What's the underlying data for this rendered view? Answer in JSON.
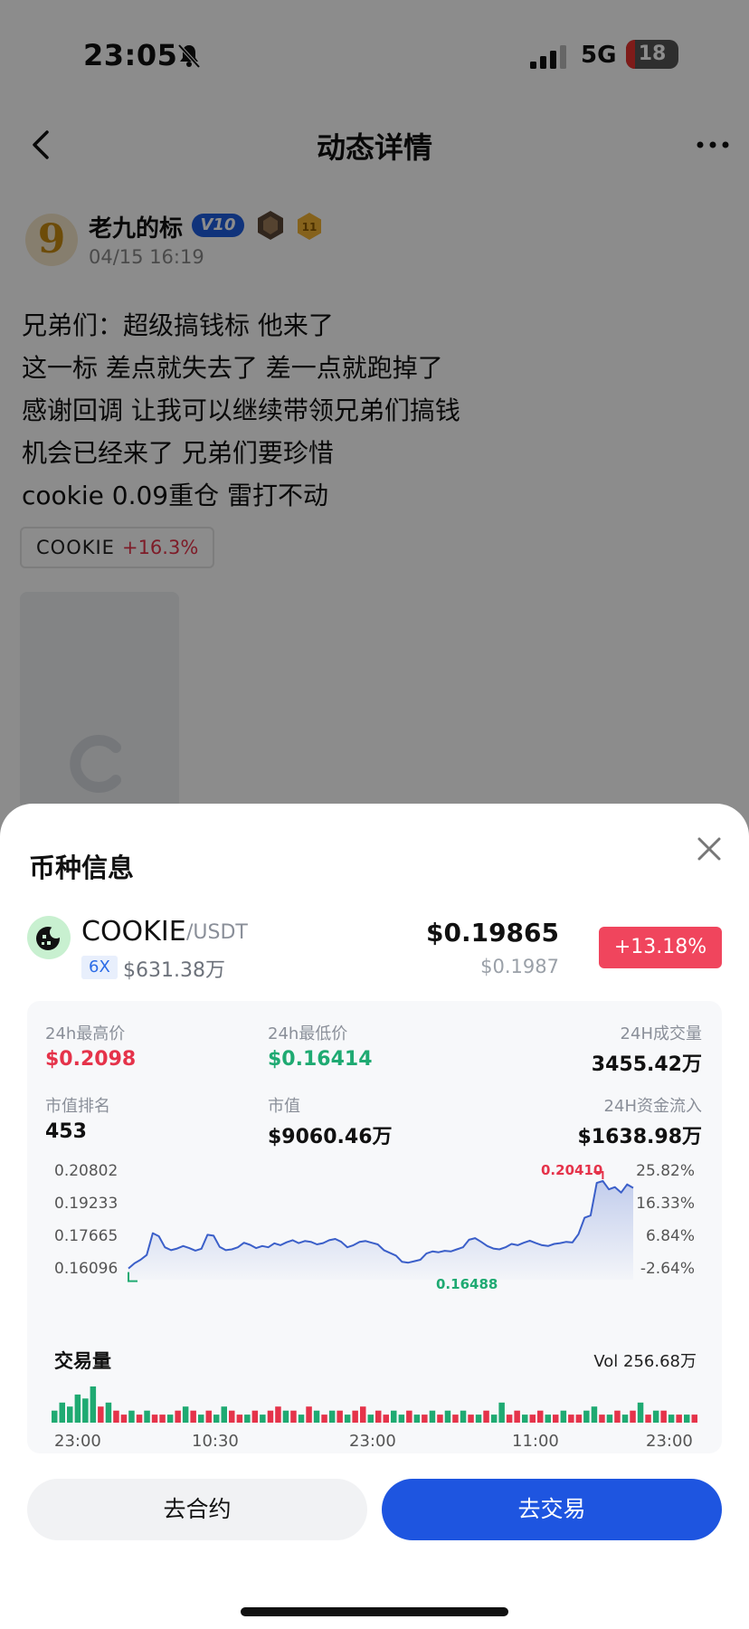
{
  "status_bar": {
    "time": "23:05",
    "network": "5G",
    "battery": "18"
  },
  "nav": {
    "title": "动态详情"
  },
  "post": {
    "author": "老九的标",
    "vip_badge": "V10",
    "level_badge": "11",
    "time": "04/15 16:19",
    "lines": [
      "兄弟们：超级搞钱标 他来了",
      "这一标 差点就失去了 差一点就跑掉了",
      "感谢回调 让我可以继续带领兄弟们搞钱",
      "机会已经来了 兄弟们要珍惜",
      "cookie 0.09重仓 雷打不动"
    ],
    "tag": {
      "name": "COOKIE",
      "change": "+16.3%"
    }
  },
  "sheet": {
    "title": "币种信息",
    "coin": {
      "symbol": "COOKIE",
      "pair": "/USDT",
      "leverage": "6X",
      "market_cap": "$631.38万",
      "price": "$0.19865",
      "price_sub": "$0.1987",
      "change": "+13.18%"
    },
    "stats": {
      "high_24h": {
        "label": "24h最高价",
        "value": "$0.2098"
      },
      "low_24h": {
        "label": "24h最低价",
        "value": "$0.16414"
      },
      "volume_24h": {
        "label": "24H成交量",
        "value": "3455.42万"
      },
      "rank": {
        "label": "市值排名",
        "value": "453"
      },
      "market_value": {
        "label": "市值",
        "value": "$9060.46万"
      },
      "flow_24h": {
        "label": "24H资金流入",
        "value": "$1638.98万"
      }
    },
    "volume": {
      "title": "交易量",
      "total": "Vol 256.68万"
    },
    "buttons": {
      "contract": "去合约",
      "trade": "去交易"
    }
  },
  "colors": {
    "up": "#e5334a",
    "down": "#1faa72",
    "line": "#3b5fc9",
    "accent": "#1e55e0"
  },
  "chart_data": [
    {
      "type": "area",
      "title": "",
      "y_ticks_left": [
        "0.20802",
        "0.19233",
        "0.17665",
        "0.16096"
      ],
      "y_ticks_right": [
        "25.82%",
        "16.33%",
        "6.84%",
        "-2.64%"
      ],
      "ylim": [
        0.16096,
        0.20802
      ],
      "x_labels": [
        "23:00",
        "10:30",
        "23:00",
        "11:00",
        "23:00"
      ],
      "high_label": "0.20410",
      "low_label": "0.16488",
      "high_value": 0.2041,
      "low_value": 0.16488,
      "values": [
        0.162,
        0.1645,
        0.1662,
        0.1685,
        0.179,
        0.1775,
        0.1722,
        0.1708,
        0.1716,
        0.1728,
        0.1718,
        0.1706,
        0.1715,
        0.1782,
        0.1778,
        0.1724,
        0.1708,
        0.1712,
        0.1722,
        0.1744,
        0.1734,
        0.1718,
        0.1728,
        0.1722,
        0.1741,
        0.1732,
        0.1746,
        0.1756,
        0.1742,
        0.1752,
        0.1748,
        0.1736,
        0.1742,
        0.1756,
        0.1762,
        0.1748,
        0.1722,
        0.1732,
        0.1748,
        0.1752,
        0.1744,
        0.1736,
        0.1708,
        0.1695,
        0.1682,
        0.1652,
        0.1648,
        0.1655,
        0.1662,
        0.1692,
        0.1702,
        0.1698,
        0.1705,
        0.1702,
        0.1712,
        0.1722,
        0.1758,
        0.1766,
        0.1748,
        0.1728,
        0.1716,
        0.1712,
        0.1722,
        0.1738,
        0.1732,
        0.1744,
        0.1754,
        0.1742,
        0.1732,
        0.1728,
        0.1738,
        0.1742,
        0.1748,
        0.1745,
        0.1785,
        0.1864,
        0.1875,
        0.2032,
        0.2041,
        0.2001,
        0.2012,
        0.1985,
        0.2025,
        0.2008
      ]
    },
    {
      "type": "bar",
      "title": "交易量",
      "total_label": "Vol 256.68万",
      "values": [
        3,
        5,
        4,
        7,
        6,
        9,
        4,
        5,
        3,
        2,
        3,
        2,
        3,
        2,
        2,
        2,
        3,
        4,
        3,
        2,
        3,
        2,
        4,
        3,
        2,
        2,
        3,
        2,
        3,
        4,
        3,
        3,
        2,
        4,
        3,
        2,
        3,
        3,
        2,
        3,
        4,
        2,
        3,
        2,
        3,
        2,
        3,
        2,
        2,
        3,
        2,
        3,
        2,
        3,
        2,
        2,
        3,
        2,
        5,
        2,
        3,
        2,
        2,
        3,
        2,
        2,
        3,
        2,
        2,
        3,
        4,
        2,
        2,
        3,
        2,
        3,
        5,
        2,
        3,
        3,
        2,
        2,
        2,
        2
      ],
      "up": [
        1,
        1,
        1,
        1,
        1,
        1,
        0,
        1,
        0,
        0,
        1,
        0,
        1,
        0,
        0,
        1,
        0,
        1,
        0,
        1,
        0,
        1,
        1,
        0,
        0,
        1,
        0,
        1,
        0,
        0,
        1,
        0,
        1,
        0,
        1,
        0,
        1,
        0,
        1,
        0,
        0,
        1,
        0,
        0,
        1,
        1,
        0,
        1,
        0,
        1,
        0,
        1,
        0,
        1,
        0,
        1,
        0,
        1,
        1,
        0,
        0,
        1,
        0,
        0,
        1,
        0,
        1,
        0,
        0,
        1,
        1,
        0,
        1,
        0,
        1,
        0,
        1,
        0,
        1,
        0,
        1,
        0,
        1,
        0
      ]
    }
  ]
}
